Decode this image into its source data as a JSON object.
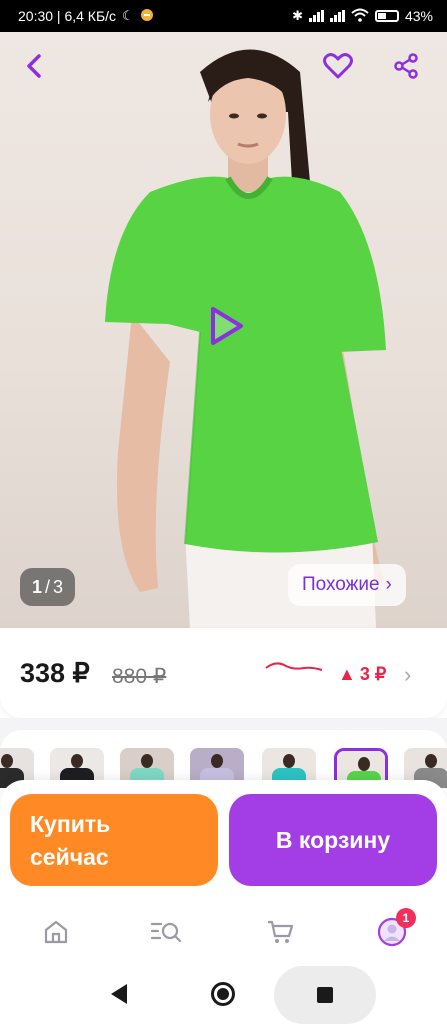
{
  "status_bar": {
    "time_speed": "20:30 | 6,4 КБ/с",
    "battery": "43%"
  },
  "photo": {
    "counter_current": "1",
    "counter_sep": "/",
    "counter_total": "3",
    "similar_label": "Похожие",
    "similar_chevron": "›"
  },
  "price": {
    "current": "338 ₽",
    "old": "880 ₽",
    "change": "3 ₽",
    "change_direction": "up",
    "change_color": "#e8244a",
    "chevron": "›"
  },
  "thumbnails": [
    {
      "shirt_color": "#2b2b2b",
      "bg": "#e7e2df",
      "selected": false
    },
    {
      "shirt_color": "#1e1e22",
      "bg": "#ece8e6",
      "selected": false
    },
    {
      "shirt_color": "#7fd8c4",
      "bg": "#d9cfc8",
      "selected": false
    },
    {
      "shirt_color": "#c7bfe2",
      "bg": "#b9aec8",
      "selected": false
    },
    {
      "shirt_color": "#2ec2c2",
      "bg": "#ece6e2",
      "selected": false
    },
    {
      "shirt_color": "#58d44a",
      "bg": "#ece6e2",
      "selected": true
    },
    {
      "shirt_color": "#8a8a8a",
      "bg": "#e9e3df",
      "selected": false
    }
  ],
  "actions": {
    "buy_now_line1": "Купить",
    "buy_now_line2": "сейчас",
    "add_to_cart": "В корзину"
  },
  "bottom_nav": {
    "items": [
      "home-icon",
      "catalog-search-icon",
      "cart-icon",
      "profile-icon"
    ],
    "profile_badge": "1"
  },
  "colors": {
    "accent_purple": "#a33de6",
    "buy_orange": "#ff8a25",
    "link_purple": "#7c2fd6"
  }
}
